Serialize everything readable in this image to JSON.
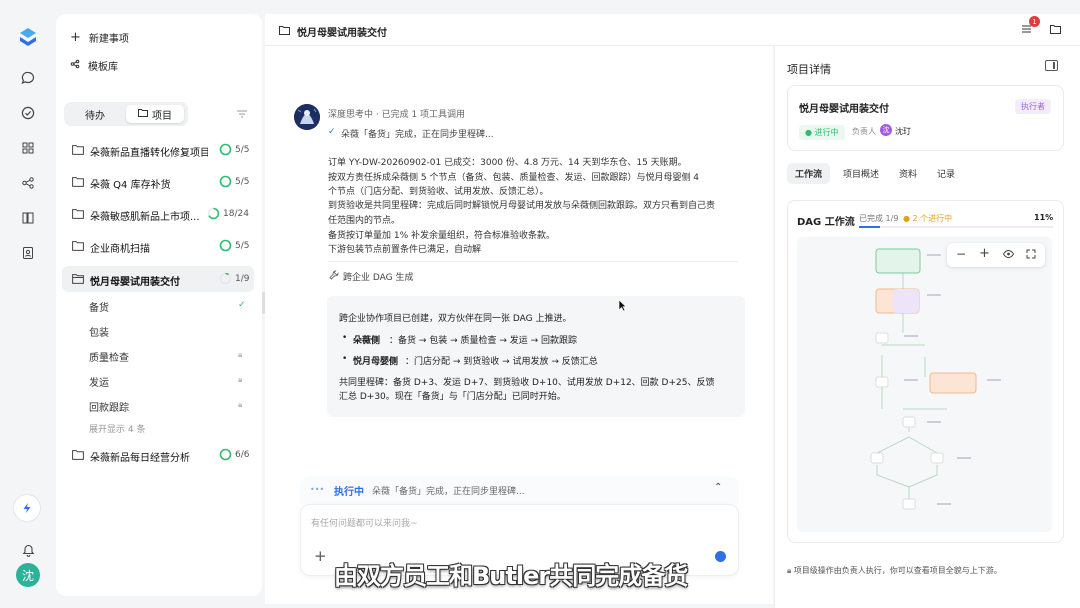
{
  "sidebar": {
    "new_item": "新建事项",
    "templates": "模板库",
    "tab_todo": "待办",
    "tab_projects": "项目",
    "projects": [
      {
        "name": "朵薇新品直播转化修复项目",
        "count": "5/5",
        "state": "done"
      },
      {
        "name": "朵薇 Q4 库存补货",
        "count": "5/5",
        "state": "done"
      },
      {
        "name": "朵薇敏感肌新品上市项...",
        "count": "18/24",
        "state": "progress"
      },
      {
        "name": "企业商机扫描",
        "count": "5/5",
        "state": "done"
      },
      {
        "name": "悦月母婴试用装交付",
        "count": "1/9",
        "state": "progress"
      }
    ],
    "subtasks": [
      {
        "name": "备货",
        "status": "done"
      },
      {
        "name": "包装",
        "status": "open"
      },
      {
        "name": "质量检查",
        "status": "locked"
      },
      {
        "name": "发运",
        "status": "locked"
      },
      {
        "name": "回款跟踪",
        "status": "locked"
      }
    ],
    "show_more": "展开显示 4 条",
    "last_project": {
      "name": "朵薇新品每日经营分析",
      "count": "6/6"
    },
    "user_initial": "沈"
  },
  "header": {
    "title": "悦月母婴试用装交付",
    "notif_count": "1"
  },
  "chat": {
    "thinking": "深度思考中 · 已完成 1 项工具调用",
    "step": "朵薇「备货」完成，正在同步里程碑...",
    "lines": [
      "订单 YY-DW-20260902-01 已成交：3000 份、4.8 万元、14 天到华东仓、15 天账期。",
      "按双方责任拆成朵薇侧 5 个节点（备货、包装、质量检查、发运、回款跟踪）与悦月母婴侧 4",
      "个节点（门店分配、到货验收、试用发放、反馈汇总）。",
      "到货验收是共同里程碑：完成后同时解锁悦月母婴试用发放与朵薇侧回款跟踪。双方只看到自己责",
      "任范围内的节点。",
      "备货按订单量加 1% 补发余量组织，符合标准验收条款。",
      "下游包装节点前置条件已满足，自动解"
    ],
    "tool_label": "跨企业 DAG 生成",
    "card_intro": "跨企业协作项目已创建，双方伙伴在同一张 DAG 上推进。",
    "bullets": [
      {
        "head": "朵薇侧",
        "body": "：备货 → 包装 → 质量检查 → 发运 → 回款跟踪"
      },
      {
        "head": "悦月母婴侧",
        "body": "：门店分配 → 到货验收 → 试用发放 → 反馈汇总"
      }
    ],
    "milestone_1": "共同里程碑：备货 D+3、发运 D+7、到货验收 D+10、试用发放 D+12、回款 D+25、反馈",
    "milestone_2": "汇总 D+30。现在「备货」与「门店分配」已同时开始。",
    "exec_status": "执行中",
    "exec_text": "朵薇「备货」完成，正在同步里程碑...",
    "input_placeholder": "有任何问题都可以来问我~"
  },
  "caption": "由双方员工和Butler共同完成备货",
  "panel": {
    "title": "项目详情",
    "project_name": "悦月母婴试用装交付",
    "role_tag": "执行者",
    "status": "进行中",
    "owner_label": "负责人",
    "owner_name": "沈玎",
    "owner_initial": "沈",
    "tabs": [
      "工作流",
      "项目概述",
      "资料",
      "记录"
    ],
    "dag_title": "DAG 工作流",
    "dag_done": "已完成 1/9",
    "dag_running": "2 个进行中",
    "dag_progress": 0.11,
    "dag_percent": "11%",
    "footer": "项目级操作由负责人执行，你可以查看项目全貌与上下游。"
  },
  "colors": {
    "accent": "#2f6fe8",
    "done": "#2dbd6e",
    "warn": "#e0a21a",
    "purple": "#9a63e8"
  }
}
